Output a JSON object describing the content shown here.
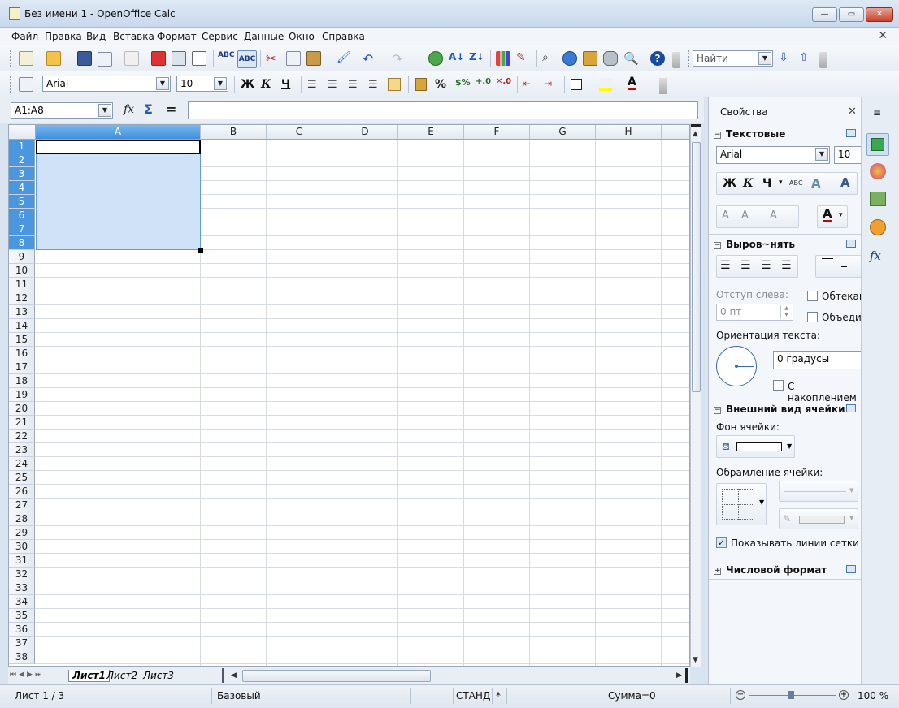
{
  "window": {
    "title": "Без имени 1 - OpenOffice Calc",
    "min": "—",
    "max": "▭",
    "close": "✕"
  },
  "menu": [
    "Файл",
    "Правка",
    "Вид",
    "Вставка",
    "Формат",
    "Сервис",
    "Данные",
    "Окно",
    "Справка"
  ],
  "menu_underline": [
    "Ф",
    "П",
    "В",
    "а",
    "Ф",
    "С",
    "Д",
    "О",
    "С"
  ],
  "find": {
    "placeholder": "Найти"
  },
  "font": {
    "name": "Arial",
    "size": "10"
  },
  "format_buttons": {
    "bold": "Ж",
    "italic": "К",
    "underline": "Ч",
    "percent": "%"
  },
  "formula": {
    "name_box": "A1:A8",
    "fx": "fx",
    "sum": "Σ",
    "eq": "=",
    "value": ""
  },
  "columns": [
    "A",
    "B",
    "C",
    "D",
    "E",
    "F",
    "G",
    "H"
  ],
  "rows": [
    "1",
    "2",
    "3",
    "4",
    "5",
    "6",
    "7",
    "8",
    "9",
    "10",
    "11",
    "12",
    "13",
    "14",
    "15",
    "16",
    "17",
    "18",
    "19",
    "20",
    "21",
    "22",
    "23",
    "24",
    "25",
    "26",
    "27",
    "28",
    "29",
    "30",
    "31",
    "32",
    "33",
    "34",
    "35",
    "36",
    "37",
    "38"
  ],
  "sheets": [
    "Лист1",
    "Лист2",
    "Лист3"
  ],
  "status": {
    "sheet": "Лист 1 / 3",
    "style": "Базовый",
    "mode": "СТАНД",
    "modified": "*",
    "sum": "Сумма=0",
    "zoom": "100 %"
  },
  "sidebar": {
    "title": "Свойства",
    "close": "✕",
    "text_section": "Текстовые",
    "font": "Arial",
    "size": "10",
    "bold": "Ж",
    "italic": "К",
    "underline": "Ч",
    "strike": "АБС",
    "align_section": "Выров~нять",
    "indent_label": "Отступ слева:",
    "indent_value": "0 пт",
    "wrap": "Обтекан",
    "merge": "Объеди",
    "orientation_label": "Ориентация текста:",
    "degrees": "0 градусы",
    "stacked": "С накоплением",
    "appearance_section": "Внешний вид ячейки",
    "bg_label": "Фон ячейки:",
    "border_label": "Обрамление ячейки:",
    "gridlines": "Показывать линии сетки",
    "number_section": "Числовой формат"
  }
}
